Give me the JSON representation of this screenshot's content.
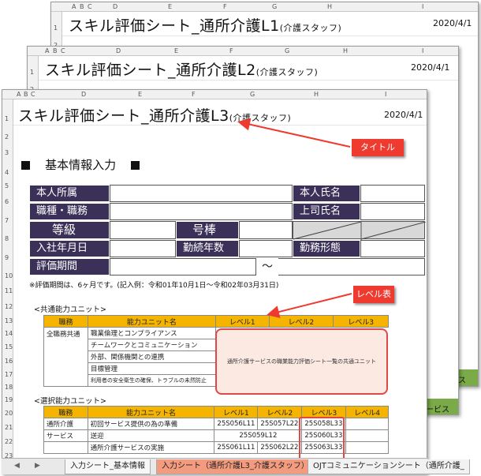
{
  "back_sheet_1": {
    "title": "スキル評価シート_通所介護L1",
    "title_suffix": "(介護スタッフ)",
    "date": "2020/4/1",
    "tab_partial": "ビス"
  },
  "back_sheet_2": {
    "title": "スキル評価シート_通所介護L2",
    "title_suffix": "(介護スタッフ)",
    "date": "2020/4/1",
    "tab_partial": "サービス"
  },
  "front_sheet": {
    "col_headers": [
      "A",
      "B",
      "C",
      "D",
      "E",
      "F",
      "G",
      "H",
      "I"
    ],
    "row_numbers": [
      "1",
      "2",
      "3",
      "4",
      "5",
      "6",
      "7",
      "8",
      "9",
      "10",
      "11",
      "12",
      "13",
      "14",
      "15",
      "16",
      "17",
      "18",
      "19",
      "20",
      "21",
      "22",
      "23"
    ],
    "title": "スキル評価シート_通所介護L3",
    "title_suffix": "(介護スタッフ)",
    "date": "2020/4/1",
    "section_heading": "基本情報入力",
    "basic_info": {
      "affiliation": "本人所属",
      "name": "本人氏名",
      "job_type": "職種・職務",
      "supervisor": "上司氏名",
      "grade": "等級",
      "number": "号棒",
      "join_date": "入社年月日",
      "years": "勤続年数",
      "work_style": "勤務形態",
      "eval_period": "評価期間",
      "tilde": "～"
    },
    "note": "※評価期間は、6ヶ月です。(記入例：令和01年10月1日～令和02年03月31日)",
    "common_unit_label": "<共通能力ユニット>",
    "common_table": {
      "headers": [
        "職務",
        "能力ユニット名",
        "レベル1",
        "レベル2",
        "レベル3"
      ],
      "job": "全職務共通",
      "units": [
        "職業倫理とコンプライアンス",
        "チームワークとコミュニケーション",
        "外部、関係機関との連携",
        "目標管理",
        "利用者の安全衛生の確保、トラブルの未然防止"
      ],
      "merged_text": "通所介護サービスの職業能力評価シート一覧の共通ユニット"
    },
    "select_unit_label": "<選択能力ユニット>",
    "select_table": {
      "headers": [
        "職務",
        "能力ユニット名",
        "レベル1",
        "レベル2",
        "レベル3",
        "レベル4"
      ],
      "job_line1": "通所介護",
      "job_line2": "サービス",
      "rows": [
        {
          "name": "初回サービス提供の為の準備",
          "l1": "25S056L11",
          "l2": "25S057L22",
          "l3": "25S058L33"
        },
        {
          "name": "送迎",
          "l12": "25S059L12",
          "l3": "25S060L33"
        },
        {
          "name": "通所介護サービスの実施",
          "l1": "25S061L11",
          "l2": "25S062L22",
          "l3": "25S063L33"
        }
      ]
    }
  },
  "callouts": {
    "title_label": "タイトル",
    "level_table_label": "レベル表"
  },
  "tabs": {
    "nav_prev": "◀",
    "nav_next": "▶",
    "items": [
      {
        "label": "入力シート_基本情報"
      },
      {
        "label": "入力シート（通所介護L3_介護スタッフ）"
      },
      {
        "label": "OJTコミュニケーションシート（通所介護_"
      }
    ]
  },
  "colors": {
    "dark_label": "#3b3158",
    "level_header": "#f4b400",
    "callout": "#ee3a2f",
    "tab_active": "#f39b7f",
    "tab_green": "#7aab48"
  }
}
